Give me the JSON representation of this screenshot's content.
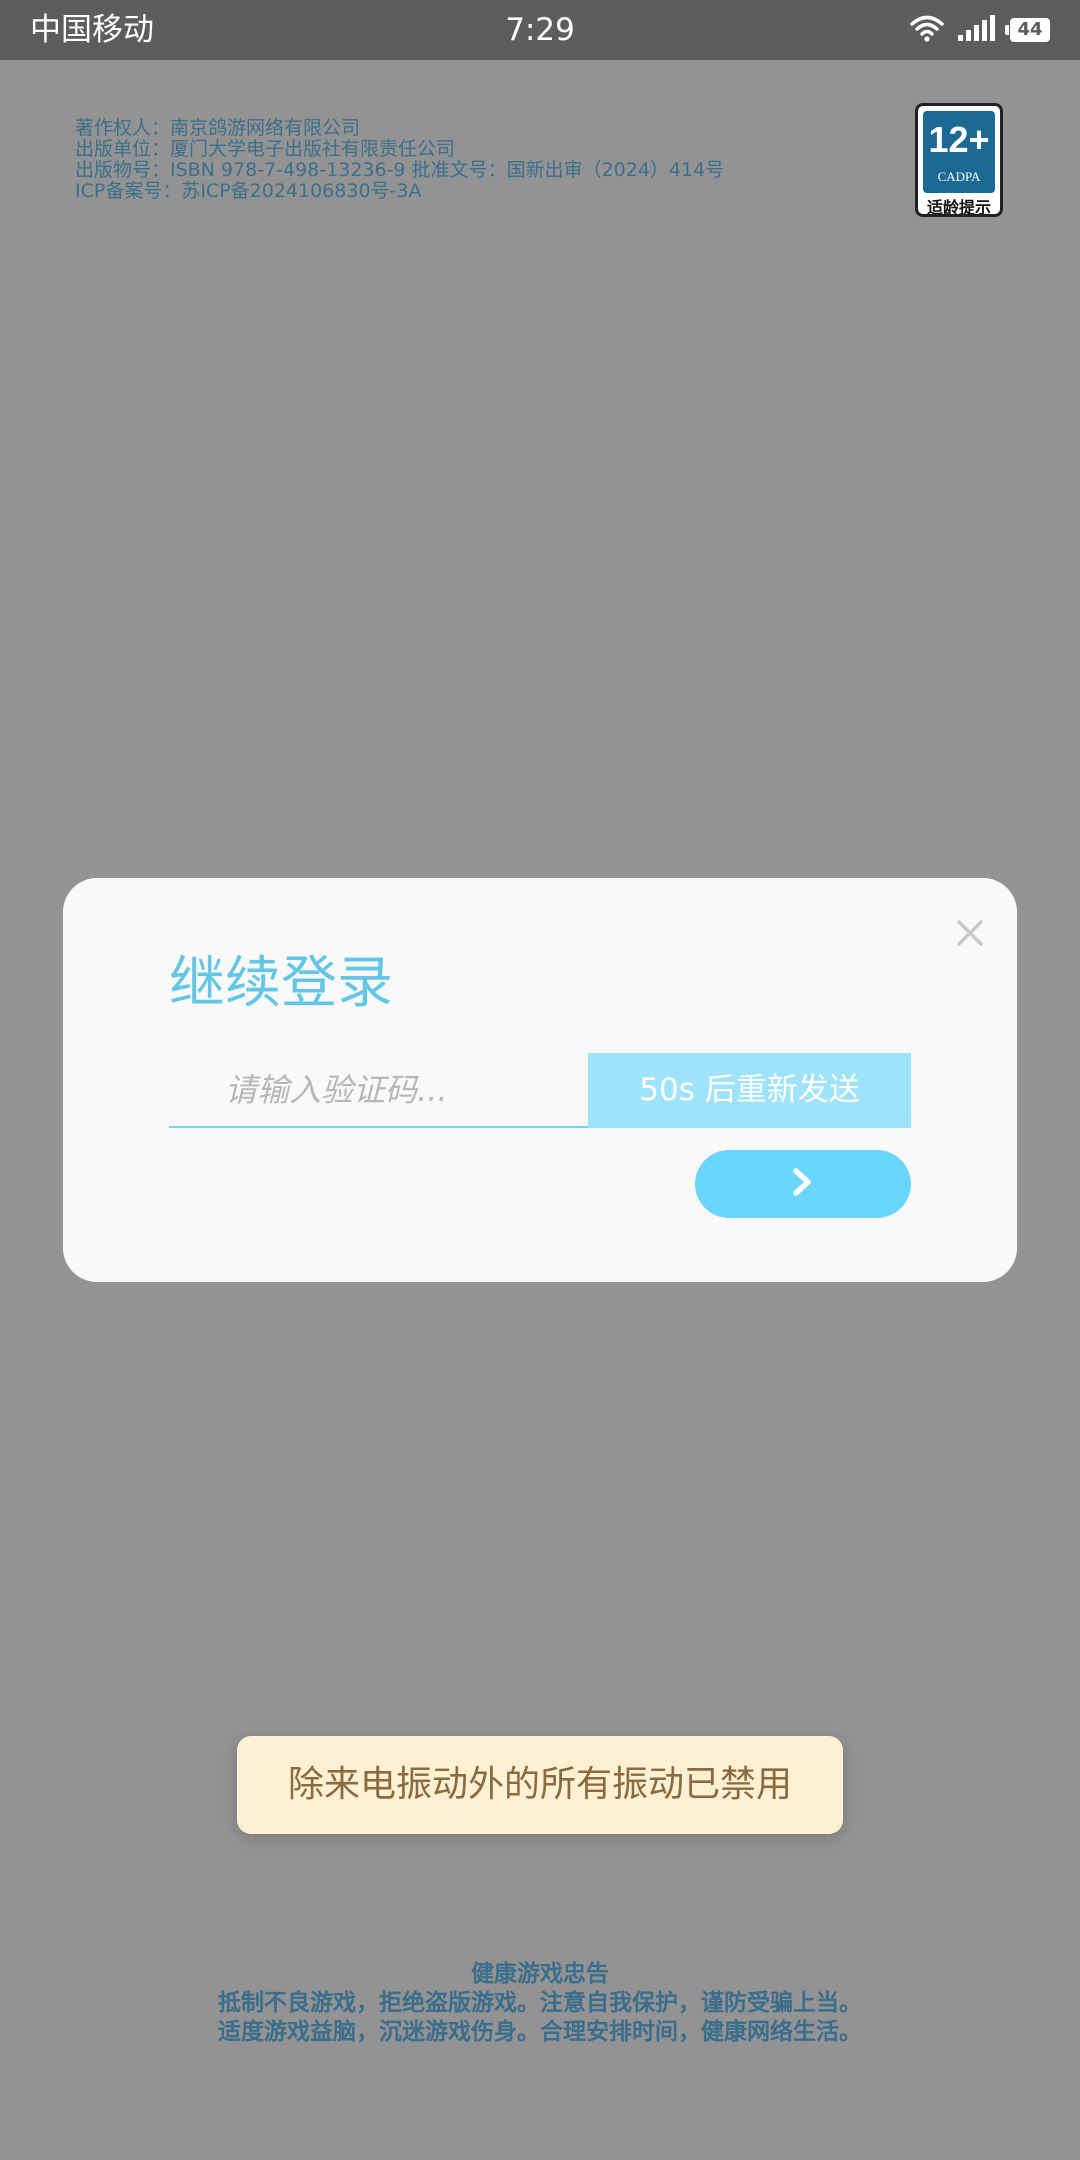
{
  "status_bar": {
    "carrier": "中国移动",
    "time": "7:29",
    "battery": "44",
    "icons": [
      "wifi-icon",
      "signal-icon",
      "battery-icon"
    ]
  },
  "legal": {
    "copyright_holder": "著作权人：南京鸽游网络有限公司",
    "publisher": "出版单位：厦门大学电子出版社有限责任公司",
    "publication_number": "出版物号：ISBN 978-7-498-13236-9 批准文号：国新出审（2024）414号",
    "icp": "ICP备案号：苏ICP备2024106830号-3A"
  },
  "age_badge": {
    "rating": "12+",
    "org": "CADPA",
    "caption": "适龄提示"
  },
  "dialog": {
    "title": "继续登录",
    "code_placeholder": "请输入验证码...",
    "resend_label": "50s 后重新发送",
    "close_icon": "close-icon",
    "submit_icon": "chevron-right-icon"
  },
  "toast": {
    "message": "除来电振动外的所有振动已禁用"
  },
  "health_notice": {
    "title": "健康游戏忠告",
    "line1": "抵制不良游戏，拒绝盗版游戏。注意自我保护，谨防受骗上当。",
    "line2": "适度游戏益脑，沉迷游戏伤身。合理安排时间，健康网络生活。"
  },
  "colors": {
    "overlay_background": "#939393",
    "status_bar": "#5d5d5d",
    "accent": "#63c6e4",
    "resend_button": "#9fe3fa",
    "submit_button": "#6bd6fb",
    "toast_background": "#fdf0d3",
    "toast_text": "#8a6a3e",
    "info_text": "#3a6e8c"
  }
}
